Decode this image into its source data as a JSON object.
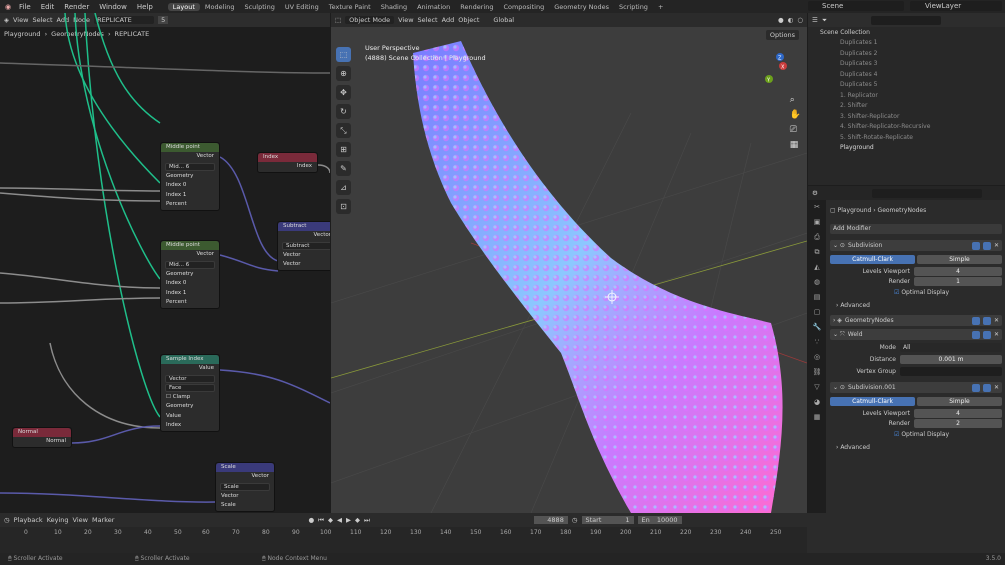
{
  "app": {
    "workspaces": [
      "Layout",
      "Modeling",
      "Sculpting",
      "UV Editing",
      "Texture Paint",
      "Shading",
      "Animation",
      "Rendering",
      "Compositing",
      "Geometry Nodes",
      "Scripting"
    ],
    "active_workspace": "Layout",
    "menus": [
      "File",
      "Edit",
      "Render",
      "Window",
      "Help"
    ],
    "scene": "Scene",
    "view_layer": "ViewLayer"
  },
  "node_editor": {
    "menus": [
      "View",
      "Select",
      "Add",
      "Node"
    ],
    "tree_name": "REPLICATE",
    "users": "5",
    "breadcrumb": [
      "Playground",
      "GeometryNodes",
      "REPLICATE"
    ],
    "nodes": {
      "mid1": {
        "title": "Middle point",
        "out": "Vector",
        "field": "Mid...",
        "users": "6",
        "inputs": [
          "Geometry",
          "Index 0",
          "Index 1",
          "Percent"
        ]
      },
      "mid2": {
        "title": "Middle point",
        "out": "Vector",
        "field": "Mid...",
        "users": "6",
        "inputs": [
          "Geometry",
          "Index 0",
          "Index 1",
          "Percent"
        ]
      },
      "index": {
        "title": "Index",
        "out": "Index"
      },
      "subtract": {
        "title": "Subtract",
        "out": "Vector",
        "op": "Subtract",
        "inputs": [
          "Vector",
          "Vector"
        ]
      },
      "sample": {
        "title": "Sample Index",
        "out": "Value",
        "type": "Vector",
        "domain": "Face",
        "clamp": "Clamp",
        "inputs": [
          "Geometry",
          "Value",
          "Index"
        ]
      },
      "normal": {
        "title": "Normal",
        "out": "Normal"
      },
      "scale": {
        "title": "Scale",
        "out": "Vector",
        "op": "Scale",
        "inputs": [
          "Vector",
          "Scale"
        ]
      }
    }
  },
  "viewport": {
    "mode": "Object Mode",
    "menus": [
      "View",
      "Select",
      "Add",
      "Object"
    ],
    "orientation": "Global",
    "options": "Options",
    "overlay_title": "User Perspective",
    "overlay_sub": "(4888) Scene Collection | Playground",
    "axes": {
      "x": "X",
      "y": "Y",
      "z": "Z"
    }
  },
  "outliner": {
    "root": "Scene Collection",
    "items": [
      "Duplicates 1",
      "Duplicates 2",
      "Duplicates 3",
      "Duplicates 4",
      "Duplicates 5",
      "1. Replicator",
      "2. Shifter",
      "3. Shifter-Replicator",
      "4. Shifter-Replicator-Recursive",
      "5. Shift-Rotate-Replicate",
      "Playground"
    ]
  },
  "properties": {
    "object": "Playground",
    "modifier_tab": "GeometryNodes",
    "add_modifier": "Add Modifier",
    "subdiv1": {
      "name": "Subdivision",
      "mode_a": "Catmull-Clark",
      "mode_b": "Simple",
      "levels_label": "Levels Viewport",
      "levels": "4",
      "render_label": "Render",
      "render": "1",
      "optimal": "Optimal Display",
      "advanced": "Advanced"
    },
    "geonodes": {
      "name": "GeometryNodes"
    },
    "weld": {
      "name": "Weld",
      "mode_label": "Mode",
      "mode": "All",
      "distance_label": "Distance",
      "distance": "0.001 m",
      "vgroup_label": "Vertex Group"
    },
    "subdiv2": {
      "name": "Subdivision.001",
      "mode_a": "Catmull-Clark",
      "mode_b": "Simple",
      "levels_label": "Levels Viewport",
      "levels": "4",
      "render_label": "Render",
      "render": "2",
      "optimal": "Optimal Display",
      "advanced": "Advanced"
    }
  },
  "timeline": {
    "menus": [
      "Playback",
      "Keying",
      "View",
      "Marker"
    ],
    "current": "4888",
    "start_label": "Start",
    "start": "1",
    "end_label": "En",
    "end": "10000",
    "ticks": [
      "0",
      "10",
      "20",
      "30",
      "40",
      "50",
      "60",
      "70",
      "80",
      "90",
      "100",
      "110",
      "120",
      "130",
      "140",
      "150",
      "160",
      "170",
      "180",
      "190",
      "200",
      "210",
      "220",
      "230",
      "240",
      "250"
    ]
  },
  "status": {
    "left": "Scroller Activate",
    "mid": "Scroller Activate",
    "right": "Node Context Menu",
    "version": "3.5.0"
  }
}
